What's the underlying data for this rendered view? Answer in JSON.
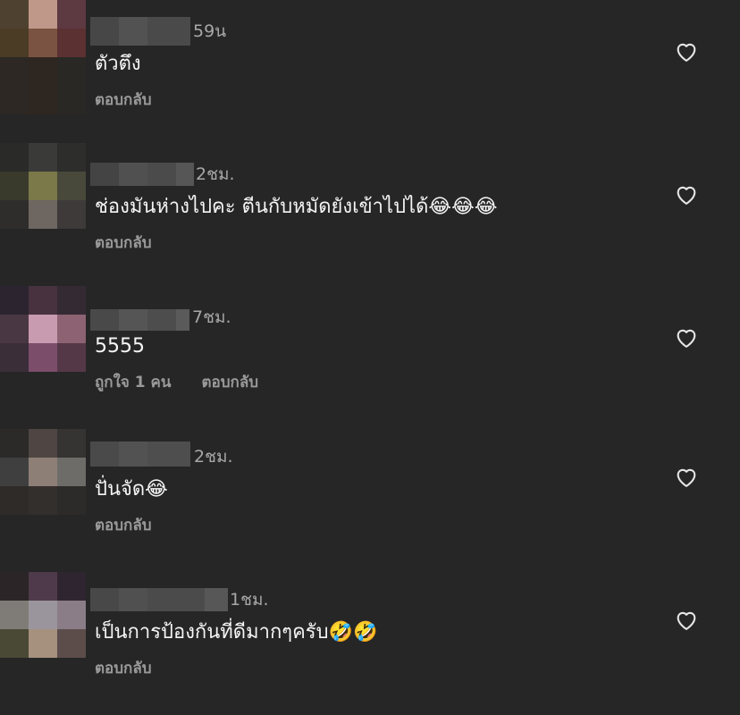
{
  "comments": [
    {
      "time": "59น",
      "text": "ตัวตึง",
      "likes": "",
      "reply": "ตอบกลับ",
      "avatar": [
        "#2b2333",
        "#2f2735",
        "#2b2530",
        "#4f4130",
        "#bf988a",
        "#5d3942",
        "#4a3c25",
        "#7b5342",
        "#5c3132",
        "#2d2824",
        "#2e2621",
        "#2a2824"
      ],
      "name": [
        "#474747",
        "#525252",
        "#4a4a4a"
      ]
    },
    {
      "time": "2ชม.",
      "text": "ช่องมันห่างไปคะ ตีนกับหมัดยังเข้าไปได้😂😂😂",
      "likes": "",
      "reply": "ตอบกลับ",
      "avatar": [
        "#2a2a28",
        "#3a3b38",
        "#2d2e2b",
        "#3a3a2c",
        "#7b7849",
        "#48493a",
        "#2e2d2c",
        "#6d6661",
        "#3d3a39"
      ],
      "name": [
        "#444",
        "#505050",
        "#4b4b4b",
        "#565656"
      ]
    },
    {
      "time": "7ชม.",
      "text": "5555",
      "likes": "ถูกใจ 1 คน",
      "reply": "ตอบกลับ",
      "avatar": [
        "#2c2530",
        "#48323f",
        "#342a33",
        "#4a3744",
        "#c89bb0",
        "#8d6272",
        "#3a2e39",
        "#7c4d6b",
        "#553848"
      ],
      "name": [
        "#494949",
        "#555",
        "#4d4d4d",
        "#5a5a5a"
      ]
    },
    {
      "time": "2ชม.",
      "text": "ปั่นจัด😂",
      "likes": "",
      "reply": "ตอบกลับ",
      "avatar": [
        "#2b2a29",
        "#4f4643",
        "#363433",
        "#3f3f3f",
        "#8e7f76",
        "#6d6c68",
        "#2f2b28",
        "#332f2c",
        "#2c2b2a"
      ],
      "name": [
        "#4a4a4a",
        "#525252",
        "#4e4e4e"
      ]
    },
    {
      "time": "1ชม.",
      "text": "เป็นการป้องกันที่ดีมากๆครับ🤣🤣",
      "likes": "",
      "reply": "ตอบกลับ",
      "avatar": [
        "#2c2528",
        "#4f3a4b",
        "#2f2530",
        "#7f7c77",
        "#9a959d",
        "#8b7d87",
        "#4a4936",
        "#a5917e",
        "#5c4d4b"
      ],
      "name": [
        "#484848",
        "#505050",
        "#4b4b4b",
        "#575757"
      ]
    }
  ]
}
